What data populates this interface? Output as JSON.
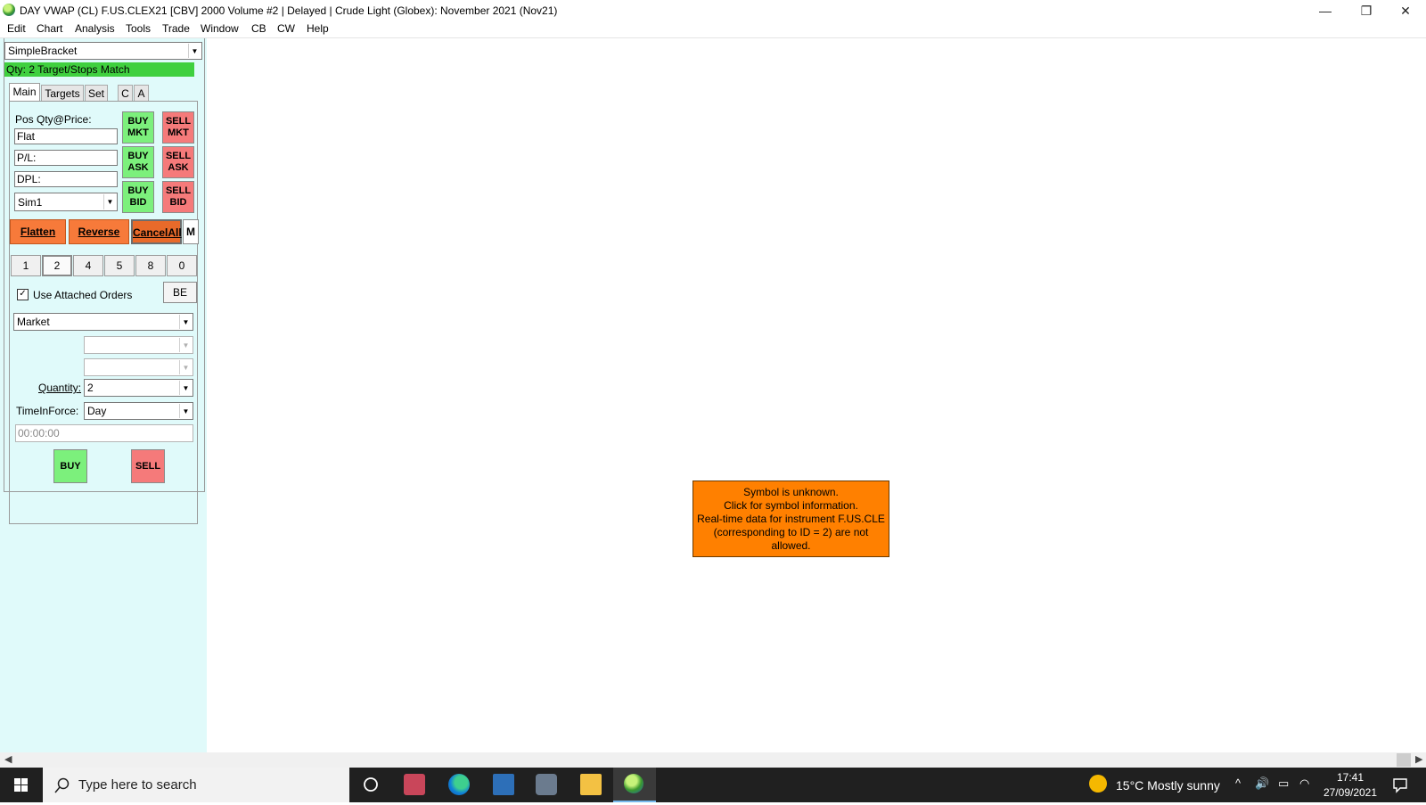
{
  "window": {
    "title": "DAY VWAP (CL) F.US.CLEX21 [CBV]  2000 Volume  #2 | Delayed | Crude Light (Globex): November 2021 (Nov21)",
    "minimize": "—",
    "restore": "❐",
    "close": "✕"
  },
  "menu": [
    "Edit",
    "Chart",
    "Analysis",
    "Tools",
    "Trade",
    "Window",
    "CB",
    "CW",
    "Help"
  ],
  "panel": {
    "strategy": "SimpleBracket",
    "status_bar": "Qty: 2 Target/Stops Match",
    "tabs": [
      "Main",
      "Targets",
      "Set",
      "C",
      "A"
    ],
    "pos_label": "Pos Qty@Price:",
    "pos_value": "Flat",
    "pl_value": "P/L:",
    "dpl_value": "DPL:",
    "account": "Sim1",
    "buy_mkt": [
      "BUY",
      "MKT"
    ],
    "sell_mkt": [
      "SELL",
      "MKT"
    ],
    "buy_ask": [
      "BUY",
      "ASK"
    ],
    "sell_ask": [
      "SELL",
      "ASK"
    ],
    "buy_bid": [
      "BUY",
      "BID"
    ],
    "sell_bid": [
      "SELL",
      "BID"
    ],
    "flatten": "Flatten",
    "reverse": "Reverse",
    "cancel_all": "CancelAll",
    "m": "M",
    "quantities": [
      "1",
      "2",
      "4",
      "5",
      "8",
      "0"
    ],
    "use_attached": "Use Attached Orders",
    "be": "BE",
    "order_type": "Market",
    "quantity_label": "Quantity:",
    "quantity_value": "2",
    "tif_label": "TimeInForce:",
    "tif_value": "Day",
    "time_placeholder": "00:00:00",
    "buy": "BUY",
    "sell": "SELL"
  },
  "message": {
    "line1": "Symbol is unknown.",
    "line2": "Click for symbol information.",
    "line3": "Real-time data for instrument F.US.CLE",
    "line4": "(corresponding to ID = 2) are not",
    "line5": "allowed."
  },
  "taskbar": {
    "search_placeholder": "Type here to search",
    "weather": "15°C  Mostly sunny",
    "time": "17:41",
    "date": "27/09/2021"
  },
  "colors": {
    "panel_bg": "#e0fafa",
    "buy": "#7cf07c",
    "sell": "#f57a7a",
    "orange": "#f77a3a",
    "message_bg": "#ff8000",
    "status_green": "#3fd03f"
  }
}
